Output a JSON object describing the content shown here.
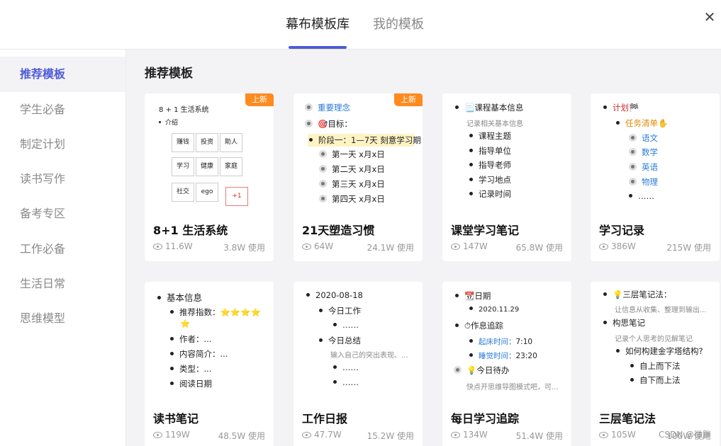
{
  "header": {
    "tabs": [
      {
        "label": "幕布模板库",
        "active": true
      },
      {
        "label": "我的模板",
        "active": false
      }
    ],
    "close_icon": "close-icon"
  },
  "sidebar": {
    "items": [
      {
        "label": "推荐模板",
        "active": true
      },
      {
        "label": "学生必备"
      },
      {
        "label": "制定计划"
      },
      {
        "label": "读书写作"
      },
      {
        "label": "备考专区"
      },
      {
        "label": "工作必备"
      },
      {
        "label": "生活日常"
      },
      {
        "label": "思维模型"
      }
    ]
  },
  "main": {
    "section_title": "推荐模板",
    "badge_label": "上新",
    "cards": [
      {
        "title": "8+1 生活系统",
        "views": "11.6W",
        "uses": "3.8W 使用",
        "badge": true
      },
      {
        "title": "21天塑造习惯",
        "views": "64W",
        "uses": "24.1W 使用",
        "badge": true
      },
      {
        "title": "课堂学习笔记",
        "views": "147W",
        "uses": "65.8W 使用",
        "badge": false
      },
      {
        "title": "学习记录",
        "views": "386W",
        "uses": "215W 使用",
        "badge": false
      },
      {
        "title": "读书笔记",
        "views": "119W",
        "uses": "48.5W 使用",
        "badge": false
      },
      {
        "title": "工作日报",
        "views": "47.7W",
        "uses": "15.2W 使用",
        "badge": false
      },
      {
        "title": "每日学习追踪",
        "views": "134W",
        "uses": "51.4W 使用",
        "badge": false
      },
      {
        "title": "三层笔记法",
        "views": "105W",
        "uses": "100W 使用",
        "badge": false
      }
    ]
  },
  "previews": {
    "c1": {
      "title": "8 + 1 生活系统",
      "sub": "介绍",
      "boxes": [
        "赚钱",
        "投资",
        "助人",
        "学习",
        "健康",
        "家庭",
        "社交",
        "ego",
        "+1"
      ]
    },
    "c2": {
      "l1": "重要理念",
      "l2": "🎯目标：",
      "l3": "阶段一：1—7天 刻意学习期",
      "l4": "第一天 x月x日",
      "l5": "第二天 x月x日",
      "l6": "第三天 x月x日",
      "l7": "第四天 x月x日"
    },
    "c3": {
      "l1": "📃课程基本信息",
      "l2": "记录相关基本信息",
      "l3": "课程主题",
      "l4": "指导单位",
      "l5": "指导老师",
      "l6": "学习地点",
      "l7": "记录时间"
    },
    "c4": {
      "l1": "计划🏁",
      "l2": "任务清单✋",
      "l3": "语文",
      "l4": "数学",
      "l5": "英语",
      "l6": "物理",
      "l7": "……"
    },
    "c5": {
      "l1": "基本信息",
      "l2": "推荐指数：",
      "l2b": "⭐⭐⭐⭐",
      "l2c": "⭐",
      "l3": "作者：...",
      "l4": "内容简介：...",
      "l5": "类型：...",
      "l6": "阅读日期"
    },
    "c6": {
      "l1": "2020-08-18",
      "l2": "今日工作",
      "l3": "……",
      "l4": "今日总结",
      "l5": "输入自己的突出表现、...",
      "l6": "……",
      "l7": "……"
    },
    "c7": {
      "l1": "📆日期",
      "l2": "2020.11.29",
      "l3": "⏱作息追踪",
      "l4a": "起床时间：",
      "l4b": "7:10",
      "l5a": "睡觉时间：",
      "l5b": "23:20",
      "l6": "💡今日待办",
      "l7": "快点开思维导图模式吧，可..."
    },
    "c8": {
      "l1": "💡三层笔记法：",
      "l2": "让信息从收集、整理到输出...",
      "l3": "构思笔记",
      "l4": "记录个人思考的见解笔记",
      "l5": "如何构建金字塔结构?",
      "l6": "自上而下法",
      "l7": "自下而上法"
    }
  },
  "watermark": "CSDN @微胖"
}
